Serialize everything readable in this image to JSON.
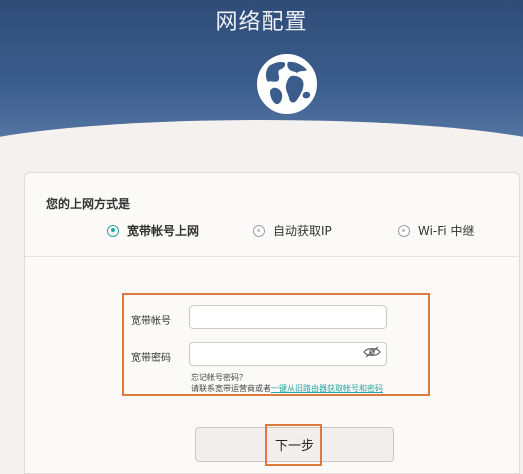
{
  "header": {
    "title": "网络配置",
    "bg_color": "#3b5d8c"
  },
  "mode_question": "您的上网方式是",
  "modes": [
    {
      "label": "宽带帐号上网",
      "selected": true
    },
    {
      "label": "自动获取IP",
      "selected": false
    },
    {
      "label": "Wi-Fi 中继",
      "selected": false
    }
  ],
  "form": {
    "account_label": "宽带帐号",
    "account_value": "",
    "password_label": "宽带密码",
    "password_value": "",
    "forgot_text": "忘记帐号密码？",
    "contact_text": "请联系宽带运营商或者",
    "link_text": "一键从旧路由器获取帐号和密码"
  },
  "next_button": "下一步",
  "colors": {
    "accent": "#2aa59d",
    "highlight": "#e07a3c"
  },
  "icons": [
    "globe-icon",
    "eye-slash-icon"
  ]
}
